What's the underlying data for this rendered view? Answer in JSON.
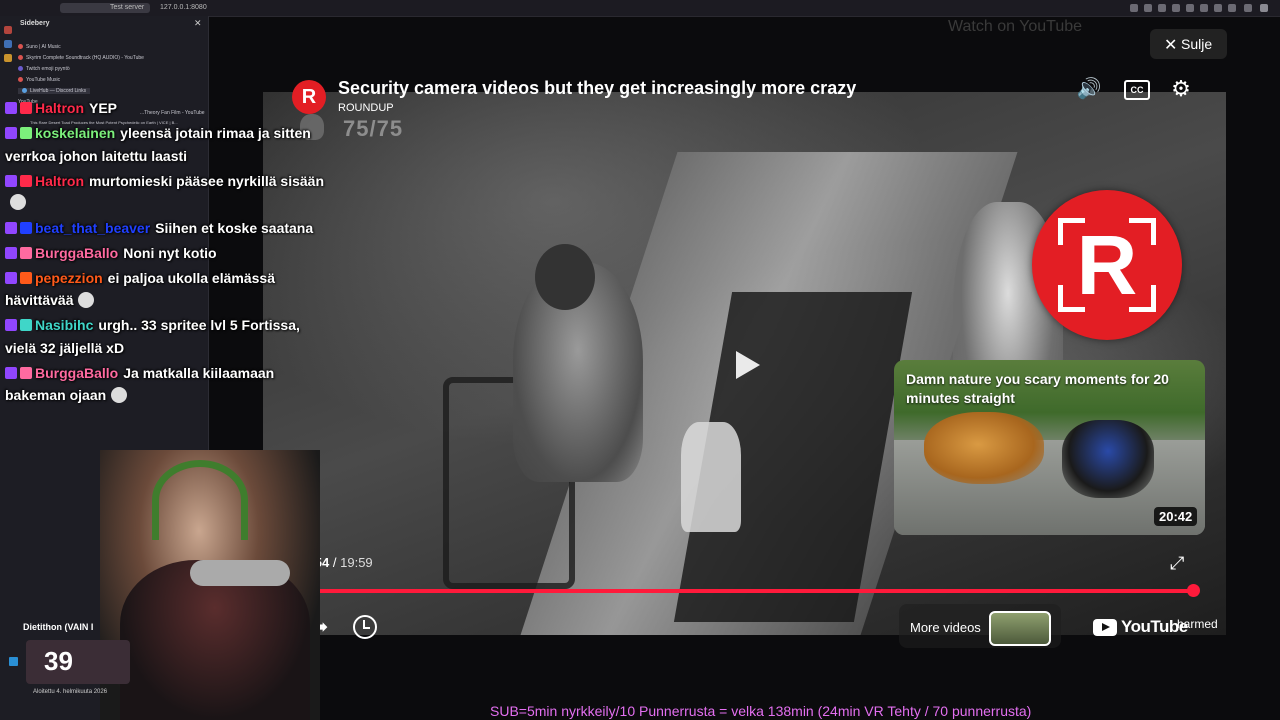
{
  "browser": {
    "tab_label": "Test server",
    "url_text": "127.0.0.1:8080"
  },
  "sidebar": {
    "title": "Sidebery",
    "items": [
      {
        "label": "Suno | AI Music"
      },
      {
        "label": "Skyrim Complete Soundtrack (HQ AUDIO) - YouTube"
      },
      {
        "label": "Twitch emoji pyyntö"
      },
      {
        "label": "YouTube Music"
      },
      {
        "label": "LiveHub — Discord Links"
      },
      {
        "label": "YouTube"
      },
      {
        "label": "...Theory Fan Film - YouTube"
      },
      {
        "label": "This Rare Desert Toad Produces the Most Potent Psychedelic on Earth | VICE | B..."
      }
    ]
  },
  "video": {
    "title": "Security camera videos but they get increasingly more crazy",
    "channel": "ROUNDUP",
    "channel_logo_letter": "R",
    "overlay_counter": "75/75",
    "close_label": "Sulje",
    "watch_on": "Watch on YouTube",
    "current_time": "19:54",
    "separator": "/",
    "duration": "19:59",
    "progress": 0.9958,
    "more_videos_label": "More videos",
    "youtube_wordmark": "YouTube",
    "harmed_text": "harmed",
    "accent": "#ff1a3b",
    "brand_red": "#e31e24"
  },
  "suggestion": {
    "title": "Damn nature you scary moments for 20 minutes straight",
    "duration": "20:42"
  },
  "icons": {
    "volume": "volume-icon",
    "captions": "CC",
    "settings": "gear-icon",
    "expand": "expand-icon",
    "share": "share-icon",
    "watch_later": "clock-icon",
    "play": "play-icon"
  },
  "chat": [
    {
      "user": "Haltron",
      "user_color": "#ff2a4a",
      "message": "YEP",
      "emote": false
    },
    {
      "user": "koskelainen",
      "user_color": "#7cf07c",
      "message": "yleensä jotain rimaa ja sitten",
      "emote": false
    },
    {
      "user": "",
      "user_color": "#ffffff",
      "message": "verrkoa johon laitettu laasti",
      "emote": false
    },
    {
      "user": "Haltron",
      "user_color": "#ff2a4a",
      "message": "murtomieski pääsee nyrkillä sisään",
      "emote": false
    },
    {
      "user": "",
      "user_color": "#ffffff",
      "message": "",
      "emote": true
    },
    {
      "user": "beat_that_beaver",
      "user_color": "#2040ff",
      "message": "Siihen et koske saatana",
      "emote": false
    },
    {
      "user": "BurggaBallo",
      "user_color": "#ff6aa0",
      "message": "Noni nyt kotio",
      "emote": false
    },
    {
      "user": "pepezzion",
      "user_color": "#ff5a1a",
      "message": "ei paljoa ukolla elämässä",
      "emote": false
    },
    {
      "user": "",
      "user_color": "#ffffff",
      "message": "hävittävää",
      "emote": true
    },
    {
      "user": "Nasibihc",
      "user_color": "#3fd6c8",
      "message": "urgh.. 33 spritee lvl 5 Fortissa,",
      "emote": false
    },
    {
      "user": "",
      "user_color": "#ffffff",
      "message": "vielä 32 jäljellä xD",
      "emote": false
    },
    {
      "user": "BurggaBallo",
      "user_color": "#ff6aa0",
      "message": "Ja matkalla kiilaamaan",
      "emote": false
    },
    {
      "user": "",
      "user_color": "#ffffff",
      "message": "bakeman ojaan",
      "emote": true
    }
  ],
  "overlay": {
    "goal_label": "Dietithon (VAIN I",
    "goal_value": "39",
    "goal_date": "Aloitettu 4. helmikuuta 2026",
    "sub_ticker": "SUB=5min nyrkkeily/10 Punnerrusta = velka 138min (24min VR Tehty / 70 punnerrusta)",
    "ticker_color": "#e36ff0"
  }
}
